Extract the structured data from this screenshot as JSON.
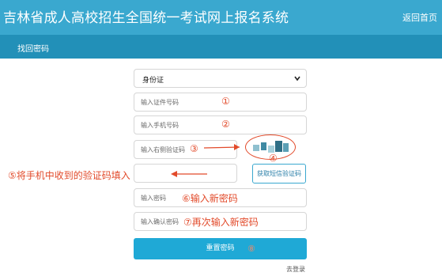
{
  "header": {
    "title": "吉林省成人高校招生全国统一考试网上报名系统",
    "home_link": "返回首页"
  },
  "subnav": {
    "label": "找回密码"
  },
  "form": {
    "id_type": {
      "value": "身份证"
    },
    "id_number": {
      "placeholder": "输入证件号码",
      "annotation": "①"
    },
    "phone": {
      "placeholder": "输入手机号码",
      "annotation": "②"
    },
    "captcha": {
      "placeholder": "输入右侧验证码",
      "annotation": "③",
      "image_annotation": "④"
    },
    "sms_code": {
      "button_label": "获取短信验证码",
      "annotation": "⑤将手机中收到的验证码填入"
    },
    "new_password": {
      "placeholder": "输入密码",
      "annotation": "⑥输入新密码"
    },
    "confirm_password": {
      "placeholder": "输入确认密码",
      "annotation": "⑦再次输入新密码"
    },
    "submit": {
      "label": "重置密码",
      "annotation": "⑧"
    },
    "login_link": "去登录"
  },
  "colors": {
    "header": "#3aa8cf",
    "subbar": "#2290b8",
    "annotation": "#e24a2a",
    "button": "#1fa9d6"
  }
}
